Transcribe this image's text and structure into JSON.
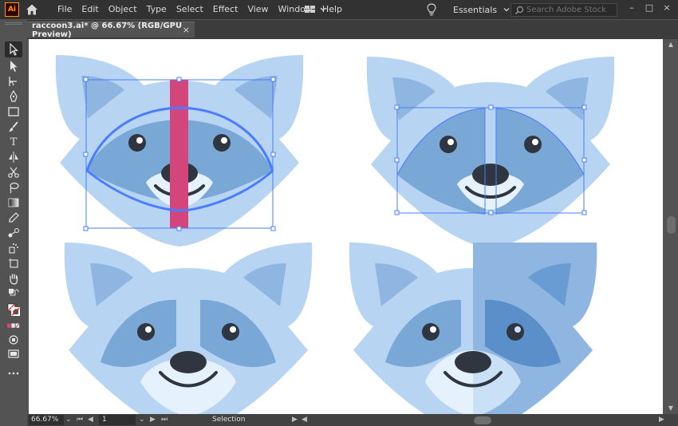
{
  "app": {
    "logo": "Ai"
  },
  "menu": [
    "File",
    "Edit",
    "Object",
    "Type",
    "Select",
    "Effect",
    "View",
    "Window",
    "Help"
  ],
  "workspace": {
    "label": "Essentials"
  },
  "search": {
    "placeholder": "Search Adobe Stock"
  },
  "document": {
    "tab_title": "raccoon3.ai* @ 66.67% (RGB/GPU Preview)",
    "close": "×"
  },
  "window": {
    "minimize": "–",
    "maximize": "□",
    "close": "×"
  },
  "status": {
    "zoom": "66.67%",
    "page": "1",
    "tool": "Selection"
  },
  "colors": {
    "accent_selection": "#4a7cff",
    "stripe": "#d4457c",
    "face_light": "#b7d4f2",
    "face_mid": "#8fb6e0",
    "mask": "#7aa8d6",
    "muzzle": "#e5f1fc",
    "nose": "#2f3640"
  }
}
